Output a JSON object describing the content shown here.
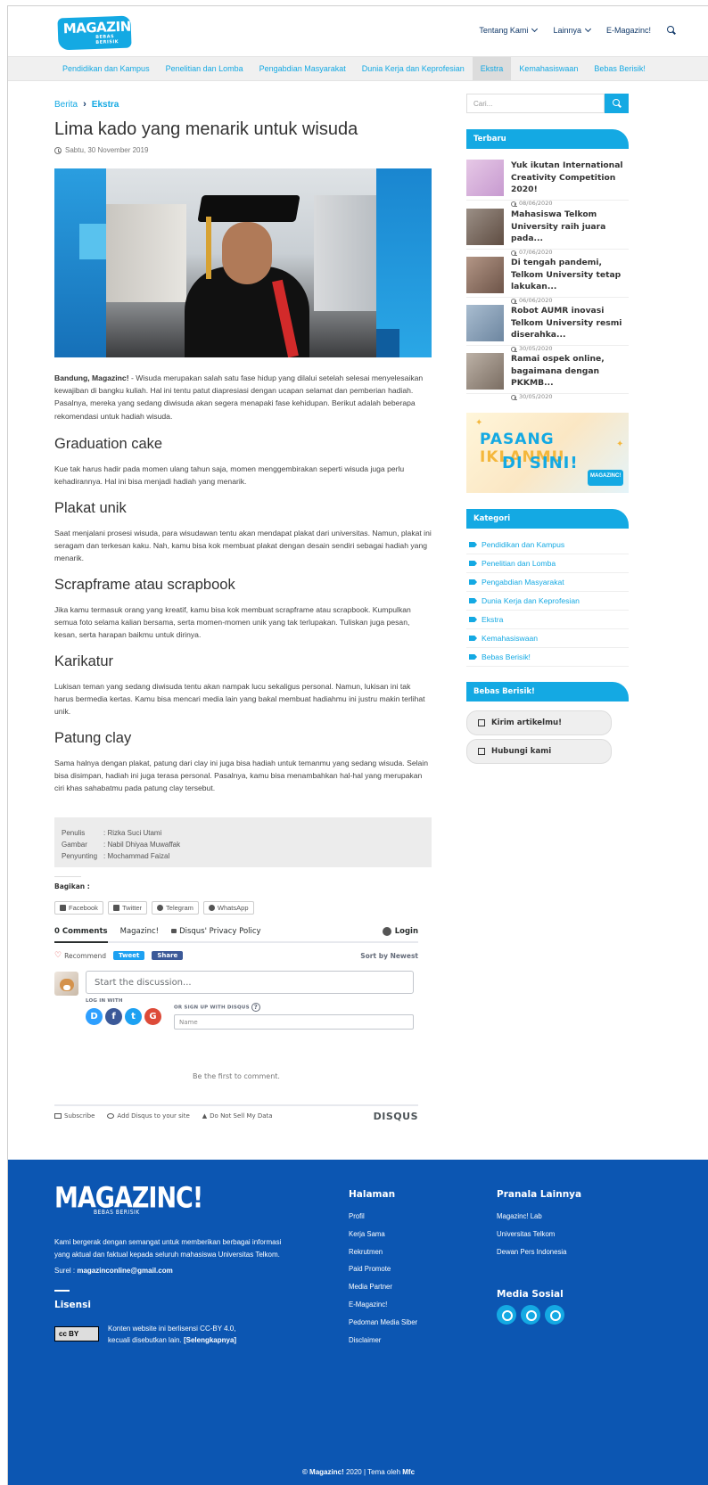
{
  "header": {
    "logo_text": "MAGAZINC!",
    "logo_tagline": "BEBAS BERISIK",
    "nav": [
      {
        "label": "Tentang Kami"
      },
      {
        "label": "Lainnya"
      },
      {
        "label": "E-Magazinc!"
      }
    ],
    "search_icon": "search-icon"
  },
  "categories_nav": [
    {
      "label": "Pendidikan dan Kampus"
    },
    {
      "label": "Penelitian dan Lomba"
    },
    {
      "label": "Pengabdian Masyarakat"
    },
    {
      "label": "Dunia Kerja dan Keprofesian"
    },
    {
      "label": "Ekstra"
    },
    {
      "label": "Kemahasiswaan"
    },
    {
      "label": "Bebas Berisik!"
    }
  ],
  "breadcrumb": {
    "root": "Berita",
    "separator": "›",
    "current": "Ekstra"
  },
  "article": {
    "title": "Lima kado yang menarik untuk wisuda",
    "date": "Sabtu, 30 November 2019",
    "lead_bold": "Bandung, Magazinc!",
    "lead_text": " - Wisuda merupakan salah satu fase hidup yang dilalui setelah selesai menyelesaikan kewajiban di bangku kuliah. Hal ini tentu patut diapresiasi dengan ucapan selamat dan pemberian hadiah. Pasalnya, mereka yang sedang diwisuda akan segera menapaki fase kehidupan. Berikut adalah beberapa rekomendasi untuk hadiah wisuda.",
    "sections": [
      {
        "heading": "Graduation cake",
        "text": "Kue tak harus hadir pada momen ulang tahun saja, momen menggembirakan seperti wisuda juga perlu kehadirannya. Hal ini bisa menjadi hadiah yang menarik."
      },
      {
        "heading": "Plakat unik",
        "text": "Saat menjalani prosesi wisuda, para wisudawan tentu akan mendapat plakat dari universitas. Namun, plakat ini seragam dan terkesan kaku. Nah, kamu bisa kok membuat plakat dengan desain sendiri sebagai hadiah yang menarik."
      },
      {
        "heading": "Scrapframe atau scrapbook",
        "text": "Jika kamu termasuk orang yang kreatif, kamu bisa kok membuat scrapframe atau scrapbook. Kumpulkan semua foto selama kalian bersama, serta momen-momen unik yang tak terlupakan. Tuliskan juga pesan, kesan, serta harapan baikmu untuk dirinya."
      },
      {
        "heading": "Karikatur",
        "text": "Lukisan teman yang sedang diwisuda tentu akan nampak lucu sekaligus personal. Namun, lukisan ini tak harus bermedia kertas. Kamu bisa mencari media lain yang bakal membuat hadiahmu ini justru makin terlihat unik."
      },
      {
        "heading": "Patung clay",
        "text": "Sama halnya dengan plakat, patung dari clay ini juga bisa hadiah untuk temanmu yang sedang wisuda. Selain bisa disimpan, hadiah ini juga terasa personal. Pasalnya, kamu bisa menambahkan hal-hal yang merupakan ciri khas sahabatmu pada patung clay tersebut."
      }
    ],
    "credits": [
      {
        "key": "Penulis",
        "value": ": Rizka Suci Utami"
      },
      {
        "key": "Gambar",
        "value": ": Nabil Dhiyaa Muwaffak"
      },
      {
        "key": "Penyunting",
        "value": ": Mochammad Faizal"
      }
    ]
  },
  "share": {
    "label": "Bagikan :",
    "buttons": [
      {
        "label": "Facebook"
      },
      {
        "label": "Twitter"
      },
      {
        "label": "Telegram"
      },
      {
        "label": "WhatsApp"
      }
    ]
  },
  "disqus": {
    "tab_comments": "0 Comments",
    "tab_site": "Magazinc!",
    "privacy": "Disqus' Privacy Policy",
    "login": "Login",
    "recommend": "Recommend",
    "tweet": "Tweet",
    "share": "Share",
    "sort": "Sort by Newest",
    "discussion_placeholder": "Start the discussion...",
    "log_in_with": "LOG IN WITH",
    "or_sign_up": "OR SIGN UP WITH DISQUS",
    "name_placeholder": "Name",
    "first_comment": "Be the first to comment.",
    "subscribe": "Subscribe",
    "add_disqus": "Add Disqus to your site",
    "do_not_sell": "Do Not Sell My Data",
    "brand": "DISQUS",
    "social": [
      {
        "letter": "D",
        "color": "#2e9fff"
      },
      {
        "letter": "f",
        "color": "#3b5998"
      },
      {
        "letter": "t",
        "color": "#1da1f2"
      },
      {
        "letter": "G",
        "color": "#dd4b39"
      }
    ]
  },
  "sidebar": {
    "search_placeholder": "Cari...",
    "latest_title": "Terbaru",
    "latest": [
      {
        "title": "Yuk ikutan International Creativity Competition 2020!",
        "date": "08/06/2020",
        "thumb": "#d9b0d8"
      },
      {
        "title": "Mahasiswa Telkom University raih juara pada...",
        "date": "07/06/2020",
        "thumb": "#7b6a5e"
      },
      {
        "title": "Di tengah pandemi, Telkom University tetap lakukan...",
        "date": "06/06/2020",
        "thumb": "#8a6f62"
      },
      {
        "title": "Robot AUMR inovasi Telkom University resmi diserahka...",
        "date": "30/05/2020",
        "thumb": "#8aa2b8"
      },
      {
        "title": "Ramai ospek online, bagaimana dengan PKKMB...",
        "date": "30/05/2020",
        "thumb": "#9c9086"
      }
    ],
    "ad_line1_a": "PASANG",
    "ad_line1_b": "IKLANMU",
    "ad_line2": "DI SINI!",
    "ad_mini": "MAGAZINC!",
    "category_title": "Kategori",
    "categories": [
      "Pendidikan dan Kampus",
      "Penelitian dan Lomba",
      "Pengabdian Masyarakat",
      "Dunia Kerja dan Keprofesian",
      "Ekstra",
      "Kemahasiswaan",
      "Bebas Berisik!"
    ],
    "bebas_title": "Bebas Berisik!",
    "btn_submit": "Kirim artikelmu!",
    "btn_contact": "Hubungi kami"
  },
  "footer": {
    "logo": "MAGAZINC!",
    "logo_tagline": "BEBAS BERISIK",
    "description": "Kami bergerak dengan semangat untuk memberikan berbagai informasi yang aktual dan faktual kepada seluruh mahasiswa Universitas Telkom.",
    "email_label": "Surel : ",
    "email": "magazinconline@gmail.com",
    "license_title": "Lisensi",
    "cc_badge": "cc BY",
    "license_text": "Konten website ini berlisensi CC-BY 4.0, kecuali disebutkan lain. ",
    "license_link": "[Selengkapnya]",
    "pages_title": "Halaman",
    "pages": [
      "Profil",
      "Kerja Sama",
      "Rekrutmen",
      "Paid Promote",
      "Media Partner",
      "E-Magazinc!",
      "Pedoman Media Siber",
      "Disclaimer"
    ],
    "links_title": "Pranala Lainnya",
    "links": [
      "Magazinc! Lab",
      "Universitas Telkom",
      "Dewan Pers Indonesia"
    ],
    "social_title": "Media Sosial",
    "copyright_brand": "© Magazinc!",
    "copyright_mid": " 2020 | Tema oleh ",
    "copyright_author": "Mfc"
  },
  "colors": {
    "accent": "#14a9e3",
    "footer": "#0c56b2",
    "nav_text": "#123a6a"
  }
}
